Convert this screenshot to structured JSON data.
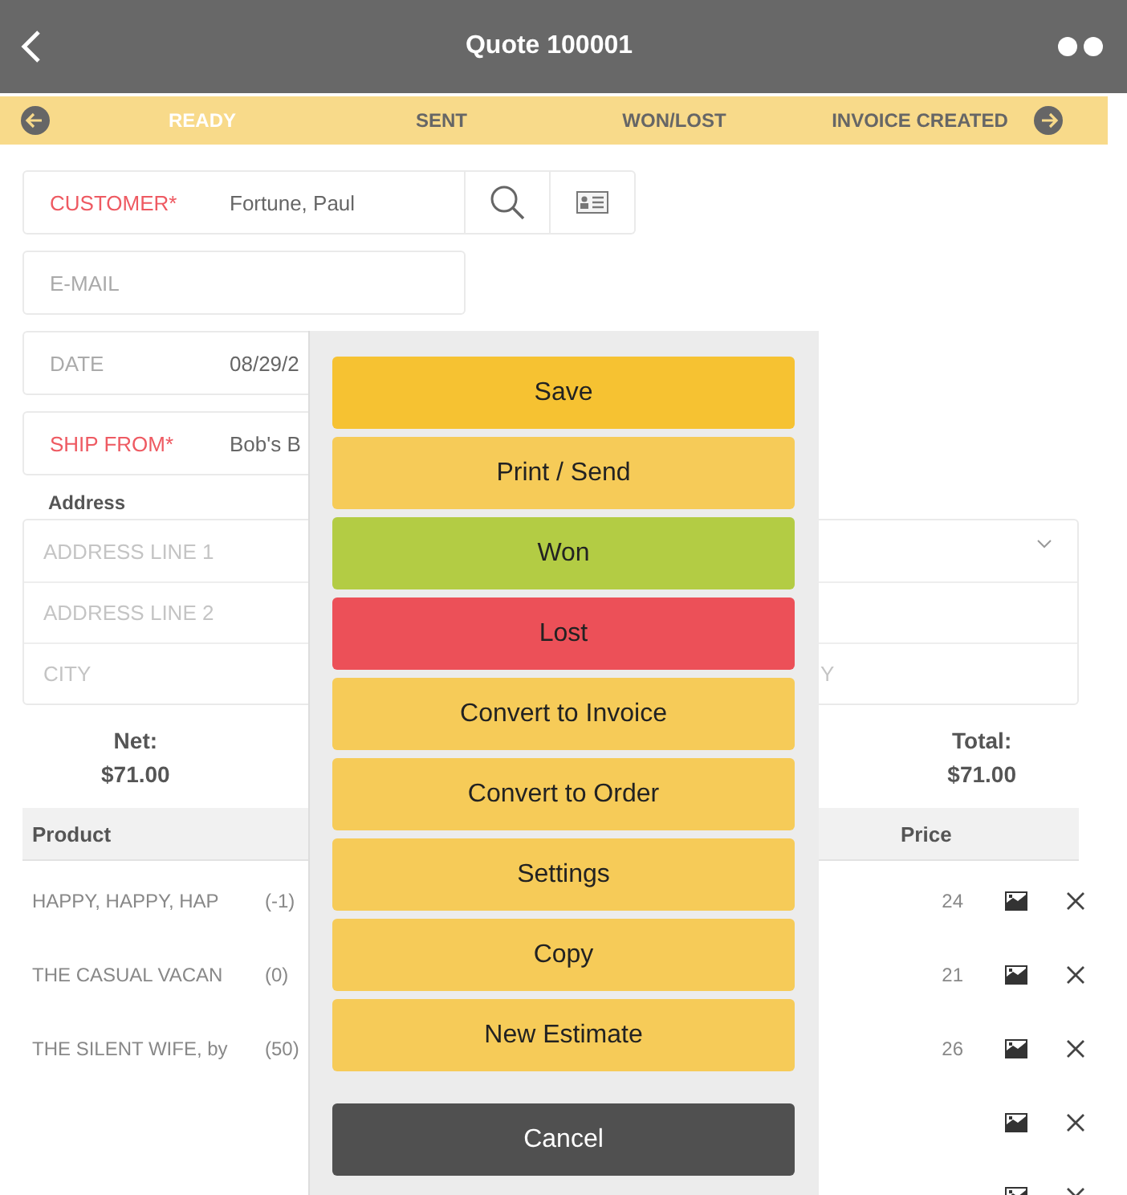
{
  "header": {
    "title": "Quote 100001"
  },
  "steps": [
    {
      "label": "READY",
      "selected": true
    },
    {
      "label": "SENT",
      "selected": false
    },
    {
      "label": "WON/LOST",
      "selected": false
    },
    {
      "label": "INVOICE CREATED",
      "selected": false
    }
  ],
  "fields": [
    {
      "label": "CUSTOMER*",
      "value": "Fortune, Paul",
      "required": true,
      "kind": "lookup"
    },
    {
      "label": "E-MAIL",
      "required": false,
      "kind": "short"
    },
    {
      "label": "DATE",
      "value": "08/29/2",
      "required": false,
      "kind": "wide"
    },
    {
      "label": "SHIP FROM*",
      "value": "Bob's B",
      "required": true,
      "kind": "wide"
    }
  ],
  "address": {
    "title": "Address",
    "lines": [
      {
        "placeholder": "ADDRESS LINE 1",
        "dropdown": true
      },
      {
        "placeholder": "ADDRESS LINE 2",
        "dropdown": false
      },
      {
        "placeholder": "CITY",
        "right": "Y",
        "dropdown": false
      }
    ]
  },
  "totals": [
    {
      "label": "Net:",
      "value": "$71.00"
    },
    {
      "label": "Total:",
      "value": "$71.00"
    }
  ],
  "table": {
    "columns": [
      "Product",
      "Price"
    ],
    "rows": [
      {
        "product": "HAPPY, HAPPY, HAP",
        "qty": "(-1)",
        "price": "24"
      },
      {
        "product": "THE CASUAL VACAN",
        "qty": "(0)",
        "price": "21"
      },
      {
        "product": "THE SILENT WIFE, by",
        "qty": "(50)",
        "price": "26"
      },
      {},
      {}
    ]
  },
  "menu": [
    {
      "label": "Save",
      "kind": "primary"
    },
    {
      "label": "Print / Send",
      "kind": "standard"
    },
    {
      "label": "Won",
      "kind": "won"
    },
    {
      "label": "Lost",
      "kind": "lost"
    },
    {
      "label": "Convert to Invoice",
      "kind": "standard"
    },
    {
      "label": "Convert to Order",
      "kind": "standard"
    },
    {
      "label": "Settings",
      "kind": "standard"
    },
    {
      "label": "Copy",
      "kind": "standard"
    },
    {
      "label": "New Estimate",
      "kind": "standard"
    },
    {
      "label": "Cancel",
      "kind": "cancel"
    }
  ]
}
